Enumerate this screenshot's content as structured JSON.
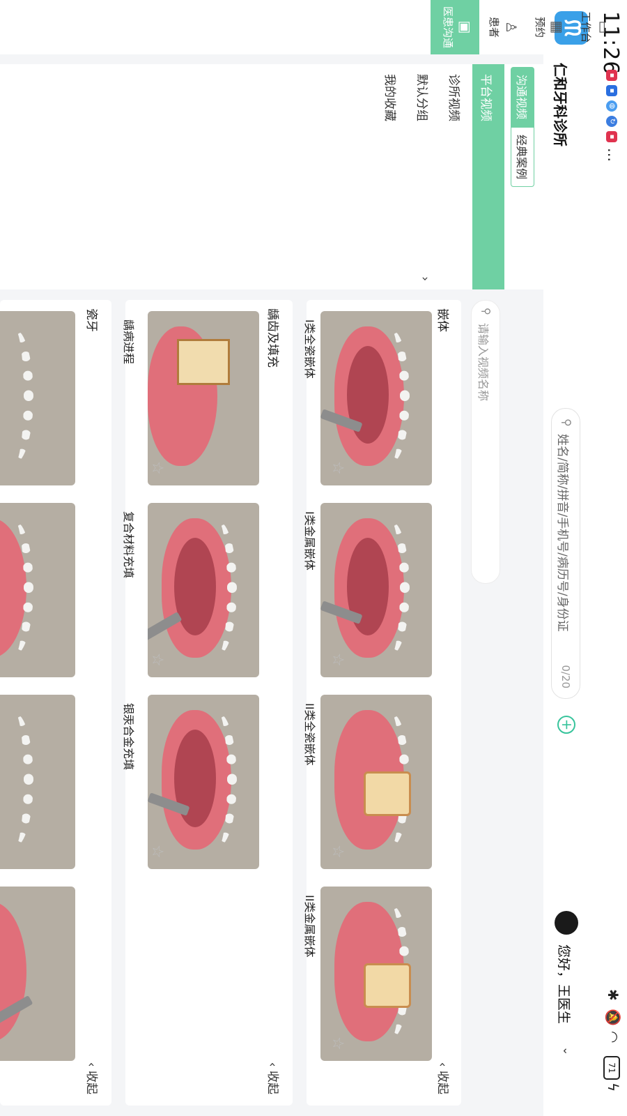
{
  "status": {
    "time": "11:26",
    "battery": "71",
    "notification_icons": [
      "app-red-icon",
      "app-blue-icon",
      "globe-icon",
      "sync-icon",
      "badge-red-icon"
    ],
    "more": "…"
  },
  "header": {
    "clinic_name": "仁和牙科诊所",
    "search_placeholder": "姓名/简称/拼音/手机号/病历号/身份证",
    "search_count": "0/20",
    "greeting": "您好，王医生"
  },
  "nav": [
    {
      "label": "工作台",
      "icon": "monitor-icon"
    },
    {
      "label": "预约",
      "icon": "calendar-icon"
    },
    {
      "label": "患者",
      "icon": "person-icon"
    },
    {
      "label": "医患沟通",
      "icon": "chat-icon",
      "active": true
    }
  ],
  "tabs": {
    "comm_video": "沟通视频",
    "classic_cases": "经典案例"
  },
  "categories": [
    {
      "label": "平台视频",
      "selected": true
    },
    {
      "label": "诊所视频"
    },
    {
      "label": "默认分组",
      "arrow": "›"
    },
    {
      "label": "我的收藏"
    }
  ],
  "video_search_placeholder": "请输入视频名称",
  "sections": [
    {
      "title": "嵌体",
      "collapse": "收起",
      "cards": [
        {
          "label": "I类全瓷嵌体"
        },
        {
          "label": "I类金属嵌体"
        },
        {
          "label": "II类全瓷嵌体"
        },
        {
          "label": "II类金属嵌体"
        }
      ]
    },
    {
      "title": "龋齿及填充",
      "collapse": "收起",
      "cards": [
        {
          "label": "龋病进程"
        },
        {
          "label": "复合材料充填"
        },
        {
          "label": "银汞合金充填"
        }
      ]
    },
    {
      "title": "瓷牙",
      "collapse": "收起",
      "cards": []
    }
  ],
  "colors": {
    "accent": "#6fd0a3",
    "brand": "#3aa0e8",
    "add": "#38c49c"
  }
}
